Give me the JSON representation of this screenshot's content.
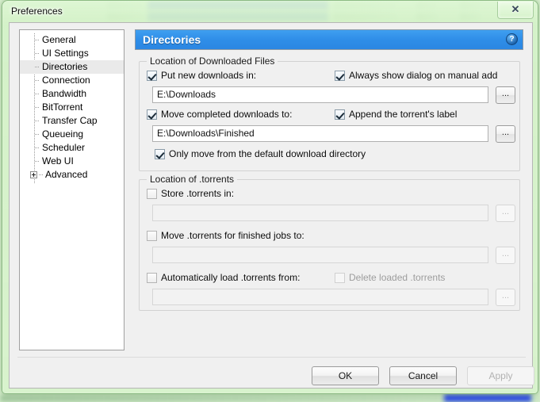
{
  "window": {
    "title": "Preferences",
    "close_label": "✕"
  },
  "sidebar": {
    "items": [
      {
        "label": "General",
        "selected": false,
        "expandable": false
      },
      {
        "label": "UI Settings",
        "selected": false,
        "expandable": false
      },
      {
        "label": "Directories",
        "selected": true,
        "expandable": false
      },
      {
        "label": "Connection",
        "selected": false,
        "expandable": false
      },
      {
        "label": "Bandwidth",
        "selected": false,
        "expandable": false
      },
      {
        "label": "BitTorrent",
        "selected": false,
        "expandable": false
      },
      {
        "label": "Transfer Cap",
        "selected": false,
        "expandable": false
      },
      {
        "label": "Queueing",
        "selected": false,
        "expandable": false
      },
      {
        "label": "Scheduler",
        "selected": false,
        "expandable": false
      },
      {
        "label": "Web UI",
        "selected": false,
        "expandable": false
      },
      {
        "label": "Advanced",
        "selected": false,
        "expandable": true
      }
    ]
  },
  "panel": {
    "title": "Directories",
    "help_glyph": "?",
    "groups": [
      {
        "legend": "Location of Downloaded Files",
        "checkbox_put_new": {
          "label": "Put new downloads in:",
          "checked": true,
          "enabled": true
        },
        "checkbox_always_dialog": {
          "label": "Always show dialog on manual add",
          "checked": true,
          "enabled": true
        },
        "field_put_new": {
          "value": "E:\\Downloads",
          "placeholder": "",
          "enabled": true
        },
        "checkbox_move_completed": {
          "label": "Move completed downloads to:",
          "checked": true,
          "enabled": true
        },
        "checkbox_append_label": {
          "label": "Append the torrent's label",
          "checked": true,
          "enabled": true
        },
        "field_move_completed": {
          "value": "E:\\Downloads\\Finished",
          "placeholder": "",
          "enabled": true
        },
        "checkbox_only_default": {
          "label": "Only move from the default download directory",
          "checked": true,
          "enabled": true
        }
      },
      {
        "legend": "Location of .torrents",
        "checkbox_store": {
          "label": "Store .torrents in:",
          "checked": false,
          "enabled": true
        },
        "field_store": {
          "value": "",
          "placeholder": "",
          "enabled": false
        },
        "checkbox_move_finished": {
          "label": "Move .torrents for finished jobs to:",
          "checked": false,
          "enabled": true
        },
        "field_move_finished": {
          "value": "",
          "placeholder": "",
          "enabled": false
        },
        "checkbox_autoload": {
          "label": "Automatically load .torrents from:",
          "checked": false,
          "enabled": true
        },
        "checkbox_delete_loaded": {
          "label": "Delete loaded .torrents",
          "checked": false,
          "enabled": false
        },
        "field_autoload": {
          "value": "",
          "placeholder": "",
          "enabled": false
        }
      }
    ],
    "browse_label": "..."
  },
  "footer": {
    "ok_label": "OK",
    "cancel_label": "Cancel",
    "apply_label": "Apply",
    "apply_enabled": false
  },
  "colors": {
    "header_blue": "#2f8ee8",
    "glass_green": "#d8f0cf",
    "client_grey": "#f0f0f0"
  }
}
